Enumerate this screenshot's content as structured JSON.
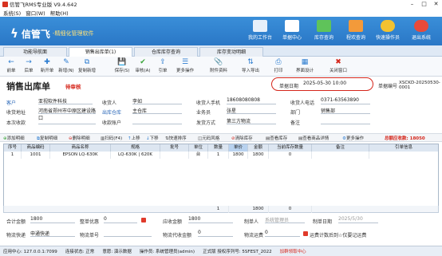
{
  "window": {
    "title": "信管飞RMS专业版 V9.4.642",
    "menu": [
      "系统(S)",
      "窗口(W)",
      "帮助(H)"
    ]
  },
  "brand": {
    "logo": "信管飞",
    "tagline": "-精细化管理软件"
  },
  "header_buttons": [
    {
      "label": "我的工作台",
      "icon": "monitor-icon"
    },
    {
      "label": "单据中心",
      "icon": "document-icon"
    },
    {
      "label": "库存查询",
      "icon": "stock-icon"
    },
    {
      "label": "程欢查询",
      "icon": "search-icon"
    },
    {
      "label": "快速操作员",
      "icon": "user-lock-icon"
    },
    {
      "label": "退出系统",
      "icon": "exit-icon"
    }
  ],
  "tabs": [
    "功能导航面",
    "销售出库单(1)",
    "仓库库存查询",
    "库存变动明细"
  ],
  "toolbar": [
    {
      "label": "前单",
      "icon": "←"
    },
    {
      "label": "后单",
      "icon": "→"
    },
    {
      "label": "新开单",
      "icon": "✚"
    },
    {
      "label": "新增(N)",
      "icon": "✎"
    },
    {
      "label": "复制新增",
      "icon": "⧉"
    },
    {
      "label": "保存(S)",
      "icon": "💾"
    },
    {
      "label": "审核(A)",
      "icon": "✔"
    },
    {
      "label": "引单",
      "icon": "⇪"
    },
    {
      "label": "更多操作",
      "icon": "☰"
    },
    {
      "label": "附件资料",
      "icon": "📎"
    },
    {
      "label": "导入导出",
      "icon": "⇅"
    },
    {
      "label": "打印",
      "icon": "⎙"
    },
    {
      "label": "界面设计",
      "icon": "▦"
    },
    {
      "label": "关闭窗口",
      "icon": "✖"
    }
  ],
  "form": {
    "title": "销售出库单",
    "status": "待审核",
    "date_label": "单据日期",
    "date_value": "2025-05-30 10:00",
    "no_label": "单据编号",
    "no_value": "XSCKD-20250530-0001",
    "fields": {
      "customer_label": "客户",
      "customer": "亚视软件科技",
      "receiver_label": "收货人",
      "receiver": "李如",
      "receiver_phone_label": "收货人手机",
      "receiver_phone": "18608080808",
      "recipient_phone_label": "收货人电话",
      "recipient_phone": "0371-63563890",
      "address_label": "收货地址",
      "address": "河南省郑州市中原区建设路口",
      "warehouse_label": "出库仓库",
      "warehouse": "主仓库",
      "salesman_label": "业务员",
      "salesman": "张星",
      "dept_label": "部门",
      "dept": "销售部",
      "debt_label": "本次收款",
      "debt": "",
      "account_label": "收款账户",
      "account": "",
      "shipping_label": "发货方式",
      "shipping": "第三方物流",
      "remark_label": "备注",
      "remark": ""
    }
  },
  "grid_toolbar": [
    "添加明细",
    "复制明细",
    "删除明细",
    "扫码(F4)",
    "上移",
    "下移",
    "快速排序",
    "元码风格",
    "清除库存",
    "查看库存",
    "查看商品详情",
    "更多操作"
  ],
  "grid_warn": "总额应收款: 18050",
  "table": {
    "columns": [
      "序号",
      "商品编码",
      "商品名称",
      "规格",
      "批号",
      "单位",
      "数量",
      "单价",
      "金额",
      "当前库存数量",
      "备注",
      "引单信息"
    ],
    "rows": [
      [
        "1",
        "1001",
        "EPSON LQ-630K",
        "LQ-630K | 620K",
        "",
        "台",
        "1",
        "1800",
        "1800",
        "0",
        "",
        ""
      ]
    ],
    "total_qty": "1",
    "total_amount": "1800",
    "total_stock": "0"
  },
  "footer": {
    "total_amount_label": "合计金额",
    "total_amount": "1800",
    "discount_label": "整单优惠",
    "discount": "0",
    "receivable_label": "应收金额",
    "receivable": "1800",
    "creator_label": "制单人",
    "creator": "系统管理员",
    "create_date_label": "制单日期",
    "create_date": "2025/5/30",
    "logistics_label": "物流快递",
    "logistics": "申通快递",
    "tracking_label": "物流单号",
    "tracking": "",
    "cod_label": "物流代收金额",
    "cod": "0",
    "freight_label": "物流运费",
    "freight": "0",
    "freight_note": "运费计数后到",
    "freight_hint": "☆仅要记运费"
  },
  "status": {
    "server": "应用中心: 127.0.0.1:7099",
    "conn": "连接状态: 正常",
    "msg": "意愿: 演示数据",
    "operator": "操作员: 系统管理员(admin)",
    "license": "正式版 授权序列号: 5SFEST_2022",
    "help": "加群领取中心"
  }
}
